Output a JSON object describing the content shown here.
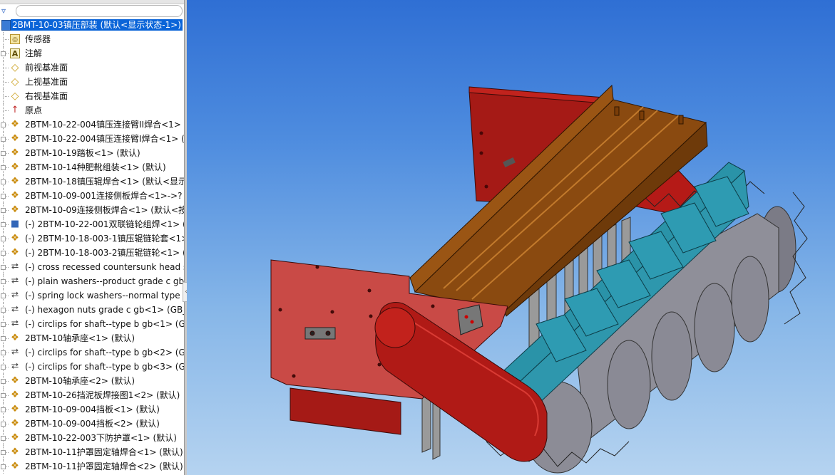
{
  "feature_tree": {
    "root_label": "2BMT-10-03镇压部装 (默认<显示状态-1>)",
    "items": [
      {
        "icon": "sensor-folder-icon",
        "label": "传感器",
        "expandable": false
      },
      {
        "icon": "annotation-icon",
        "label": "注解",
        "expandable": true
      },
      {
        "icon": "plane-icon",
        "label": "前视基准面",
        "expandable": false
      },
      {
        "icon": "plane-icon",
        "label": "上视基准面",
        "expandable": false
      },
      {
        "icon": "plane-icon",
        "label": "右视基准面",
        "expandable": false
      },
      {
        "icon": "origin-icon",
        "label": "原点",
        "expandable": false
      },
      {
        "icon": "subassembly-icon",
        "label": "2BTM-10-22-004镇压连接臂II焊合<1> (",
        "expandable": true
      },
      {
        "icon": "subassembly-icon",
        "label": "2BTM-10-22-004镇压连接臂I焊合<1> (默",
        "expandable": true
      },
      {
        "icon": "subassembly-icon",
        "label": "2BTM-10-19踏板<1> (默认)",
        "expandable": true
      },
      {
        "icon": "subassembly-icon",
        "label": "2BTM-10-14种肥靴组装<1> (默认)",
        "expandable": true
      },
      {
        "icon": "subassembly-icon",
        "label": "2BTM-10-18镇压辊焊合<1> (默认<显示",
        "expandable": true
      },
      {
        "icon": "subassembly-icon",
        "label": "2BTM-10-09-001连接侧板焊合<1>->? (",
        "expandable": true
      },
      {
        "icon": "subassembly-icon",
        "label": "2BTM-10-09连接侧板焊合<1> (默认<按",
        "expandable": true
      },
      {
        "icon": "part-icon",
        "label": "(-) 2BTM-10-22-001双联链轮组焊<1> (",
        "expandable": true
      },
      {
        "icon": "subassembly-icon",
        "label": "(-) 2BTM-10-18-003-1镇压辊链轮套<1>",
        "expandable": true
      },
      {
        "icon": "subassembly-icon",
        "label": "(-) 2BTM-10-18-003-2镇压辊链轮<1> (",
        "expandable": true
      },
      {
        "icon": "bolt-icon",
        "label": "(-) cross recessed countersunk head s",
        "expandable": true
      },
      {
        "icon": "bolt-icon",
        "label": "(-) plain washers--product grade c gb",
        "expandable": true
      },
      {
        "icon": "bolt-icon",
        "label": "(-) spring lock washers--normal type g",
        "expandable": true
      },
      {
        "icon": "bolt-icon",
        "label": "(-) hexagon nuts grade c gb<1> (GB_F",
        "expandable": true
      },
      {
        "icon": "bolt-icon",
        "label": "(-) circlips for shaft--type b gb<1> (GE",
        "expandable": true
      },
      {
        "icon": "subassembly-icon",
        "label": "2BTM-10轴承座<1> (默认)",
        "expandable": true
      },
      {
        "icon": "bolt-icon",
        "label": "(-) circlips for shaft--type b gb<2> (GE",
        "expandable": true
      },
      {
        "icon": "bolt-icon",
        "label": "(-) circlips for shaft--type b gb<3> (GE",
        "expandable": true
      },
      {
        "icon": "subassembly-icon",
        "label": "2BTM-10轴承座<2> (默认)",
        "expandable": true
      },
      {
        "icon": "subassembly-icon",
        "label": "2BTM-10-26挡泥板焊接图1<2> (默认)",
        "expandable": true
      },
      {
        "icon": "subassembly-icon",
        "label": "2BTM-10-09-004挡板<1> (默认)",
        "expandable": true
      },
      {
        "icon": "subassembly-icon",
        "label": "2BTM-10-09-004挡板<2> (默认)",
        "expandable": true
      },
      {
        "icon": "subassembly-icon",
        "label": "2BTM-10-22-003下防护罩<1> (默认)",
        "expandable": true
      },
      {
        "icon": "subassembly-icon",
        "label": "2BTM-10-11护罩固定轴焊合<1> (默认)",
        "expandable": true
      },
      {
        "icon": "subassembly-icon",
        "label": "2BTM-10-11护罩固定轴焊合<2> (默认)",
        "expandable": true
      }
    ]
  },
  "colors": {
    "selection": "#0a64d8",
    "viewport_top": "#2f6fd4",
    "viewport_bottom": "#b5d3f0",
    "frame_red": "#a51a16",
    "side_plate": "#c94a46",
    "channel_brown": "#8a4a10",
    "shield_teal": "#2a93a8",
    "roller_grey": "#8f8f99"
  }
}
